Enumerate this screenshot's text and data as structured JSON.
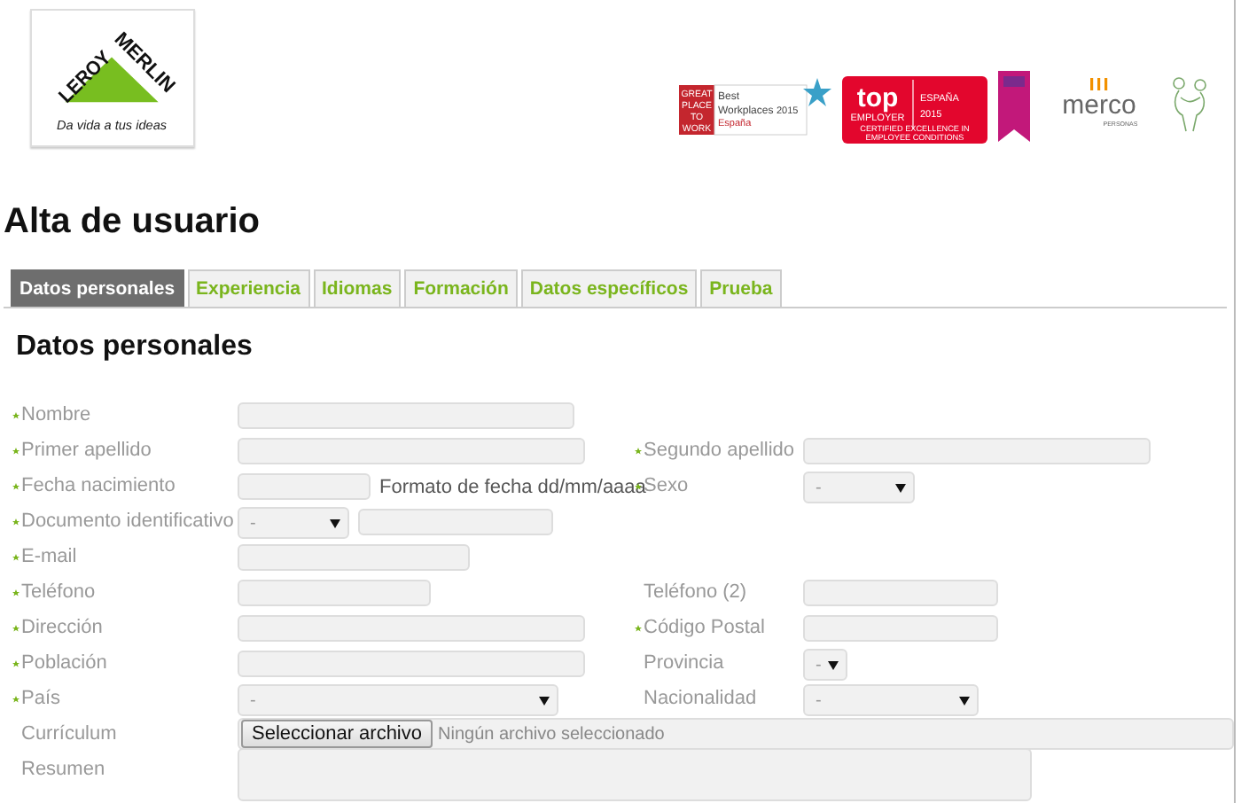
{
  "header": {
    "logo": {
      "word_left": "LEROY",
      "word_right": "MERLIN",
      "slogan": "Da vida a tus ideas"
    },
    "awards": {
      "great_place": {
        "badge_lines": [
          "GREAT",
          "PLACE",
          "TO",
          "WORK"
        ],
        "title": "Best",
        "title_2": "Workplaces",
        "year": "2015",
        "country": "España"
      },
      "top_employer": {
        "brand": "top",
        "sub": "EMPLOYER",
        "country": "ESPAÑA",
        "year": "2015",
        "footer": "CERTIFIED EXCELLENCE IN EMPLOYEE CONDITIONS"
      },
      "merco": {
        "name": "merco",
        "sub": "PERSONAS"
      }
    }
  },
  "page_title": "Alta de usuario",
  "tabs": [
    {
      "label": "Datos personales",
      "selected": true
    },
    {
      "label": "Experiencia",
      "selected": false
    },
    {
      "label": "Idiomas",
      "selected": false
    },
    {
      "label": "Formación",
      "selected": false
    },
    {
      "label": "Datos específicos",
      "selected": false
    },
    {
      "label": "Prueba",
      "selected": false
    }
  ],
  "section_title": "Datos personales",
  "rows": [
    {
      "left": {
        "label": "Nombre",
        "required": true,
        "kind": "text"
      }
    },
    {
      "left": {
        "label": "Primer apellido",
        "required": true,
        "kind": "text"
      },
      "right": {
        "label": "Segundo apellido",
        "required": true,
        "kind": "text"
      }
    },
    {
      "left": {
        "label": "Fecha nacimiento",
        "required": true,
        "kind": "date",
        "hint": "Formato de fecha dd/mm/aaaa"
      },
      "right": {
        "label": "Sexo",
        "required": true,
        "kind": "select",
        "value": "-"
      }
    },
    {
      "left": {
        "label": "Documento identificativo",
        "required": true,
        "kind": "document",
        "value": "-"
      }
    },
    {
      "left": {
        "label": "E-mail",
        "required": true,
        "kind": "text"
      }
    },
    {
      "left": {
        "label": "Teléfono",
        "required": true,
        "kind": "text"
      },
      "right": {
        "label": "Teléfono (2)",
        "required": false,
        "kind": "text"
      }
    },
    {
      "left": {
        "label": "Dirección",
        "required": true,
        "kind": "text"
      },
      "right": {
        "label": "Código Postal",
        "required": true,
        "kind": "text"
      }
    },
    {
      "left": {
        "label": "Población",
        "required": true,
        "kind": "text"
      },
      "right": {
        "label": "Provincia",
        "required": false,
        "kind": "select",
        "value": "-"
      }
    },
    {
      "left": {
        "label": "País",
        "required": true,
        "kind": "select",
        "value": "-"
      },
      "right": {
        "label": "Nacionalidad",
        "required": false,
        "kind": "select",
        "value": "-"
      }
    },
    {
      "left": {
        "label": "Currículum",
        "required": false,
        "kind": "file",
        "button": "Seleccionar archivo",
        "status": "Ningún archivo seleccionado"
      }
    },
    {
      "left": {
        "label": "Resumen",
        "required": false,
        "kind": "textarea"
      }
    }
  ]
}
